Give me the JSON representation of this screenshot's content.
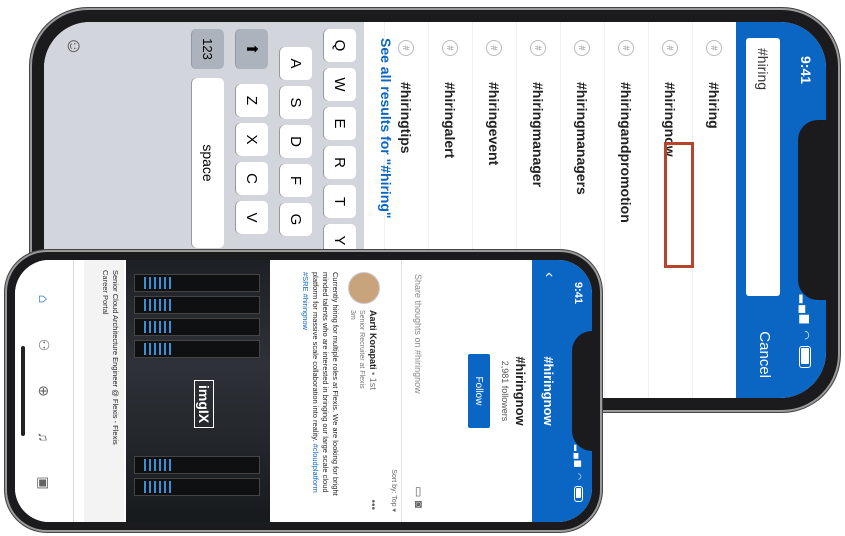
{
  "search_phone": {
    "status": {
      "time": "9:41"
    },
    "search": {
      "value": "#hiring",
      "cancel_label": "Cancel"
    },
    "results": [
      {
        "label": "#hiring"
      },
      {
        "label": "#hiringnow",
        "highlighted": true
      },
      {
        "label": "#hiringandpromotion"
      },
      {
        "label": "#hiringmanagers"
      },
      {
        "label": "#hiringmanager"
      },
      {
        "label": "#hiringevent"
      },
      {
        "label": "#hiringalert"
      },
      {
        "label": "#hiringtips"
      }
    ],
    "see_all": "See all results for \"#hiring\"",
    "keyboard": {
      "row1": [
        "Q",
        "W",
        "E",
        "R",
        "T",
        "Y"
      ],
      "row2": [
        "A",
        "S",
        "D",
        "F",
        "G"
      ],
      "row3": [
        "Z",
        "X",
        "C",
        "V"
      ],
      "numbers_key": "123",
      "space_key": "space",
      "shift_icon": "shift-arrow-icon",
      "emoji_icon": "emoji-icon"
    },
    "highlight_color": "#b5462b"
  },
  "feed_phone": {
    "status": {
      "time": "9:41"
    },
    "header": {
      "title": "#hiringnow",
      "tag_name": "#hiringnow",
      "followers": "2,981 followers",
      "follow_label": "Follow"
    },
    "share": {
      "placeholder": "Share thoughts on #hiringnow"
    },
    "sort": {
      "label": "Sort by: Top"
    },
    "post": {
      "author": "Aarti Korapati",
      "degree": "• 1st",
      "title": "Senior Recruiter at Flexis",
      "time": "3m",
      "body": "Currently hiring for multiple roles at Flexis. We are looking for bright minded talents who are interested in bringing our large scale cloud platform for massive scale collaboration into reality.",
      "hashtags": "#cloudplatform #SRE #hiringnow",
      "image_logo": "imgIX",
      "link_title": "Senior Cloud Architecture Engineer @ Flexis - Flexis",
      "link_subtitle": "Career Portal"
    },
    "nav_icons": [
      "home-icon",
      "network-icon",
      "post-icon",
      "notifications-icon",
      "jobs-icon"
    ]
  },
  "brand_color": "#0a66c2"
}
